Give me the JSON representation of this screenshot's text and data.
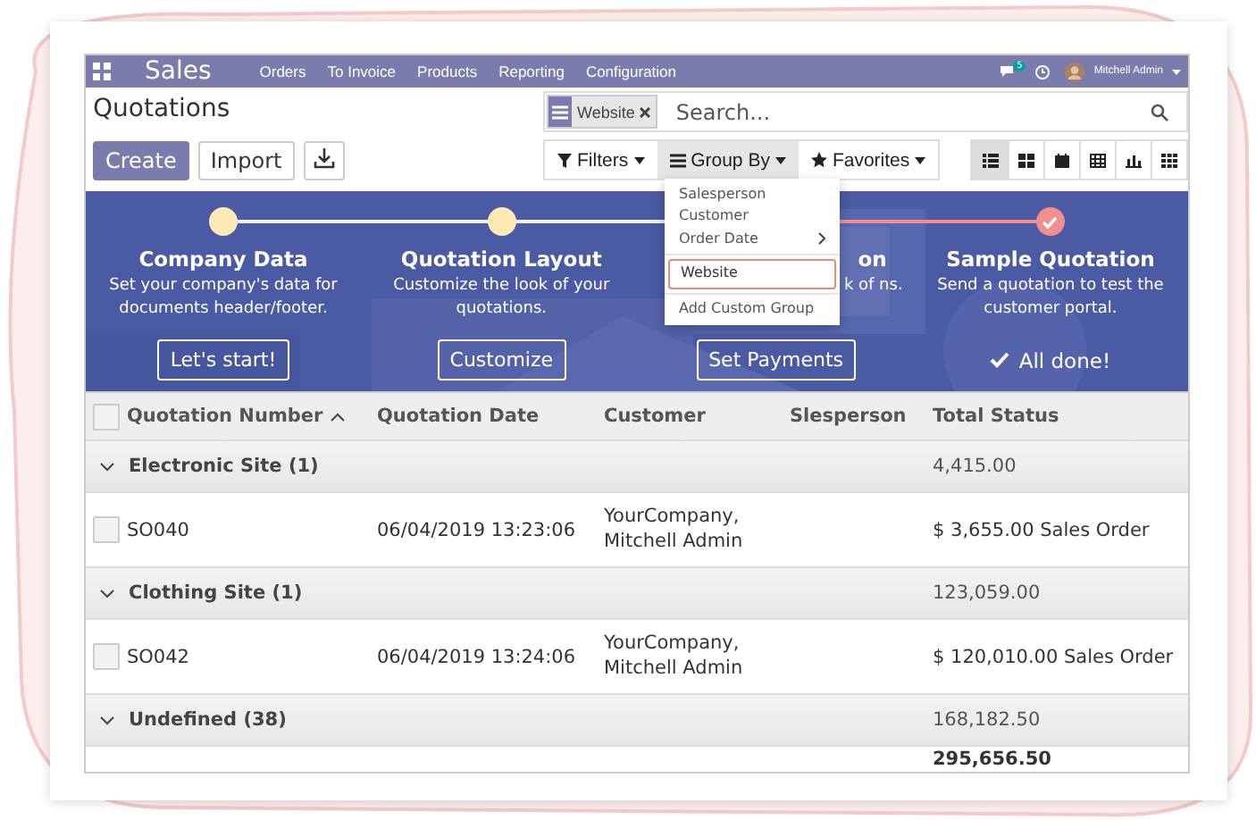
{
  "navbar": {
    "app": "Sales",
    "menu": [
      "Orders",
      "To Invoice",
      "Products",
      "Reporting",
      "Configuration"
    ],
    "message_count": "5",
    "user": "Mitchell Admin"
  },
  "page": {
    "title": "Quotations",
    "buttons": [
      {
        "label": "Create",
        "kind": "primary"
      },
      {
        "label": "Import",
        "kind": "secondary"
      }
    ]
  },
  "search": {
    "facet": "Website",
    "placeholder": "Search..."
  },
  "filters": [
    {
      "label": "Filters",
      "kind": "filter",
      "selected": false
    },
    {
      "label": "Group By",
      "kind": "group",
      "selected": true
    },
    {
      "label": "Favorites",
      "kind": "star",
      "selected": false
    }
  ],
  "views": [
    {
      "kind": "list",
      "selected": true
    },
    {
      "kind": "kanban",
      "selected": false
    },
    {
      "kind": "calendar",
      "selected": false
    },
    {
      "kind": "pivot",
      "selected": false
    },
    {
      "kind": "graph",
      "selected": false
    },
    {
      "kind": "grid",
      "selected": false
    }
  ],
  "group_by_menu": [
    [
      {
        "label": "Salesperson",
        "kind": "option",
        "selected": false
      },
      {
        "label": "Customer",
        "kind": "option",
        "selected": false
      },
      {
        "label": "Order Date",
        "kind": "submenu",
        "selected": false
      }
    ],
    [
      {
        "label": "Website",
        "kind": "option",
        "selected": true
      }
    ],
    [
      {
        "label": "Add Custom Group",
        "kind": "custom",
        "selected": false
      }
    ]
  ],
  "steps": [
    {
      "title": "Company Data",
      "description": "Set your company's data for documents header/footer.",
      "action": "Let's start!",
      "kind": "button",
      "done": false
    },
    {
      "title": "Quotation Layout",
      "description": "Customize the look of your quotations.",
      "action": "Customize",
      "kind": "button",
      "done": false
    },
    {
      "title": "on",
      "description": "k of ns.",
      "action": "Set Payments",
      "kind": "hidden"
    },
    {
      "title": "Sample Quotation",
      "description": "Send a quotation to test the customer portal.",
      "action": "All done!",
      "kind": "done",
      "done": true
    }
  ],
  "table": {
    "columns": [
      "Quotation Number",
      "Quotation Date",
      "Customer",
      "Slesperson",
      "Total Status"
    ],
    "groups": [
      {
        "label": "Electronic Site (1)",
        "total": "4,415.00",
        "rows": [
          {
            "number": "SO040",
            "date": "06/04/2019 13:23:06",
            "customer": "YourCompany, Mitchell Admin",
            "total_status": "$ 3,655.00 Sales Order",
            "selected": false
          }
        ]
      },
      {
        "label": "Clothing Site (1)",
        "total": "123,059.00",
        "rows": [
          {
            "number": "SO042",
            "date": "06/04/2019 13:24:06",
            "customer": "YourCompany, Mitchell Admin",
            "total_status": "$ 120,010.00 Sales Order",
            "selected": false
          }
        ]
      },
      {
        "label": "Undefined (38)",
        "total": "168,182.50"
      }
    ],
    "all_selected": false,
    "grand_total": "295,656.50"
  }
}
